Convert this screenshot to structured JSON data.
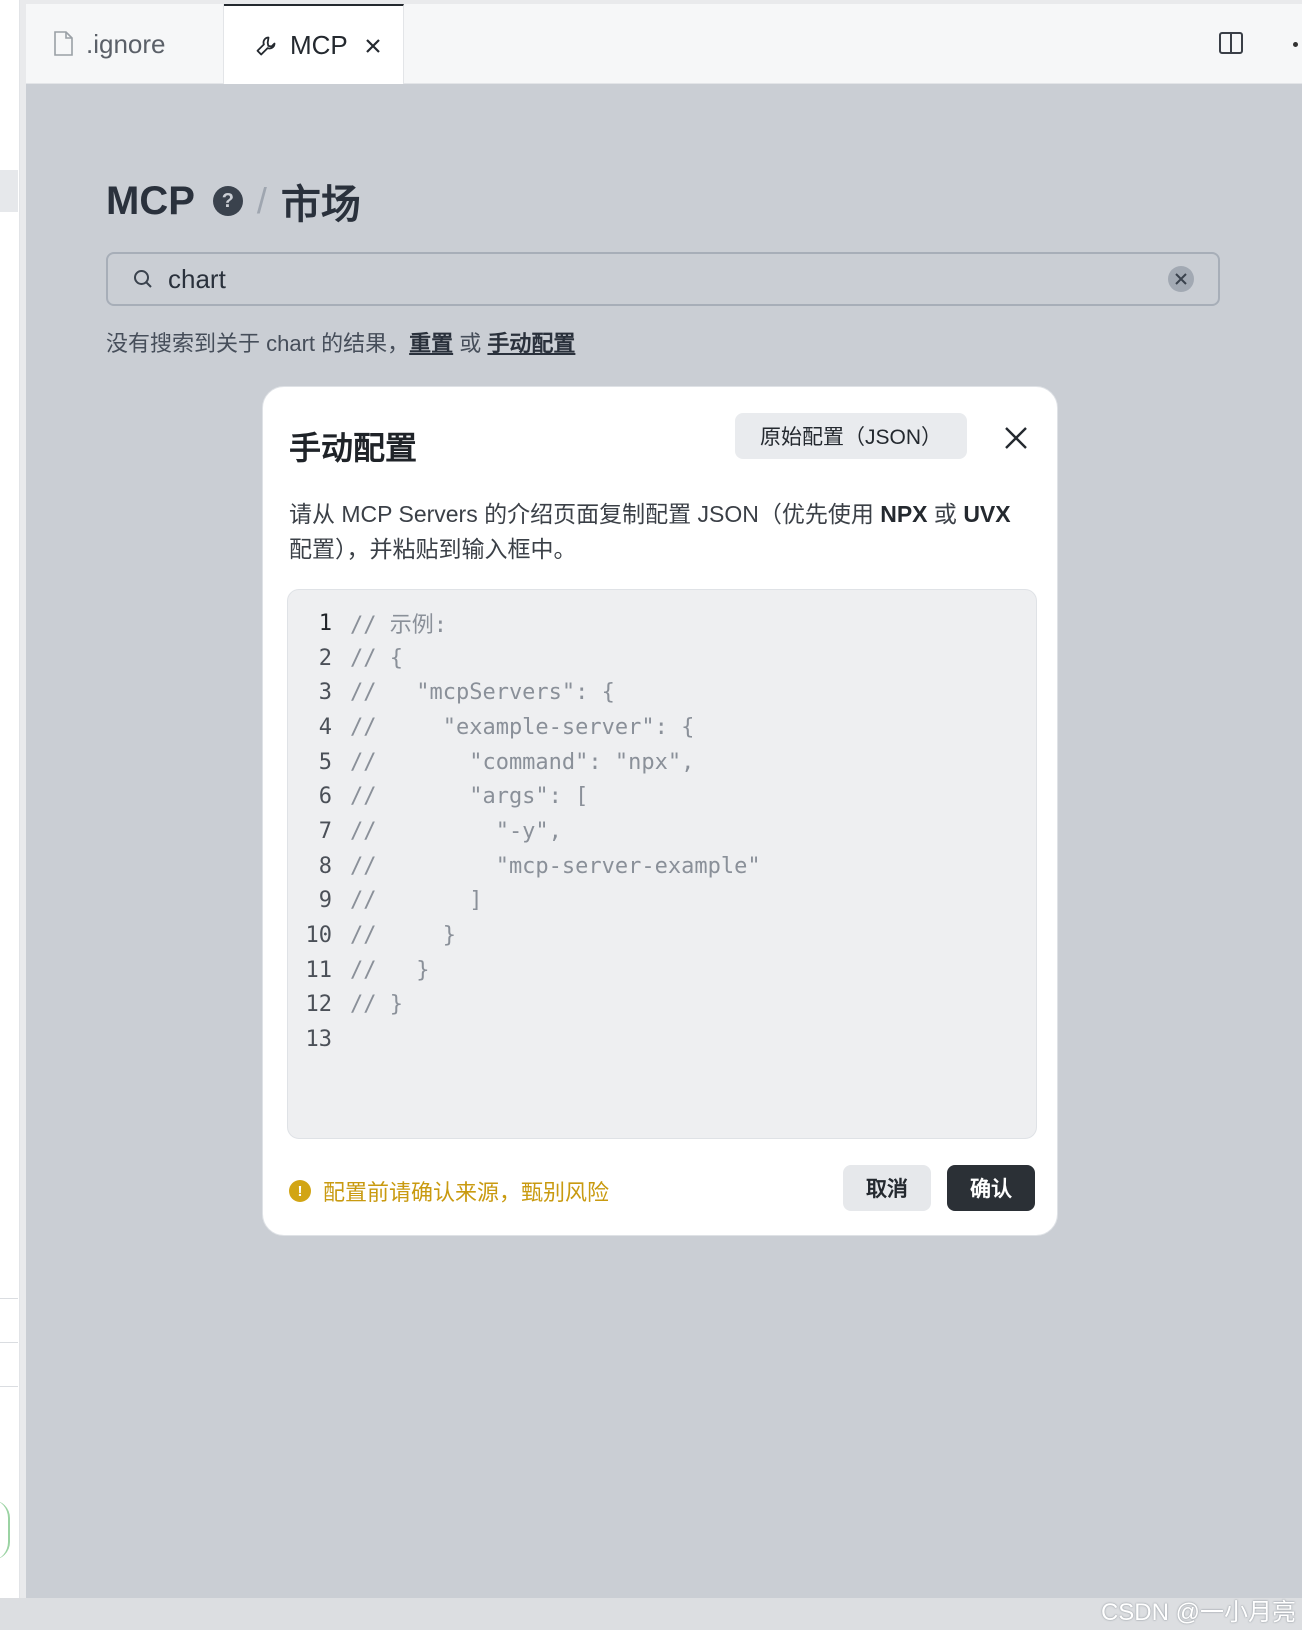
{
  "tabs": [
    {
      "label": ".ignore",
      "icon": "file-icon",
      "active": false
    },
    {
      "label": "MCP",
      "icon": "wrench-icon",
      "active": true
    }
  ],
  "page": {
    "title": "MCP",
    "help": "?",
    "separator": "/",
    "subtitle": "市场"
  },
  "search": {
    "value": "chart"
  },
  "no_result": {
    "prefix": "没有搜索到关于 chart 的结果，",
    "reset_link": "重置",
    "or": " 或 ",
    "manual_link": "手动配置"
  },
  "modal": {
    "title": "手动配置",
    "raw_button": "原始配置（JSON）",
    "desc_part1": "请从 MCP Servers 的介绍页面复制配置 JSON（优先使用 ",
    "desc_npx": "NPX",
    "desc_or": " 或 ",
    "desc_uvx": "UVX",
    "desc_part2": " 配置），并粘贴到输入框中。",
    "code_lines": [
      "// 示例:",
      "// {",
      "//   \"mcpServers\": {",
      "//     \"example-server\": {",
      "//       \"command\": \"npx\",",
      "//       \"args\": [",
      "//         \"-y\",",
      "//         \"mcp-server-example\"",
      "//       ]",
      "//     }",
      "//   }",
      "// }",
      ""
    ],
    "warning_icon": "!",
    "warning": "配置前请确认来源，甄别风险",
    "cancel": "取消",
    "confirm": "确认"
  },
  "watermark": "CSDN @一小月亮",
  "colors": {
    "accent_dark": "#2b3036",
    "warning": "#c99a10",
    "overlay": "rgba(60,75,95,0.27)"
  }
}
